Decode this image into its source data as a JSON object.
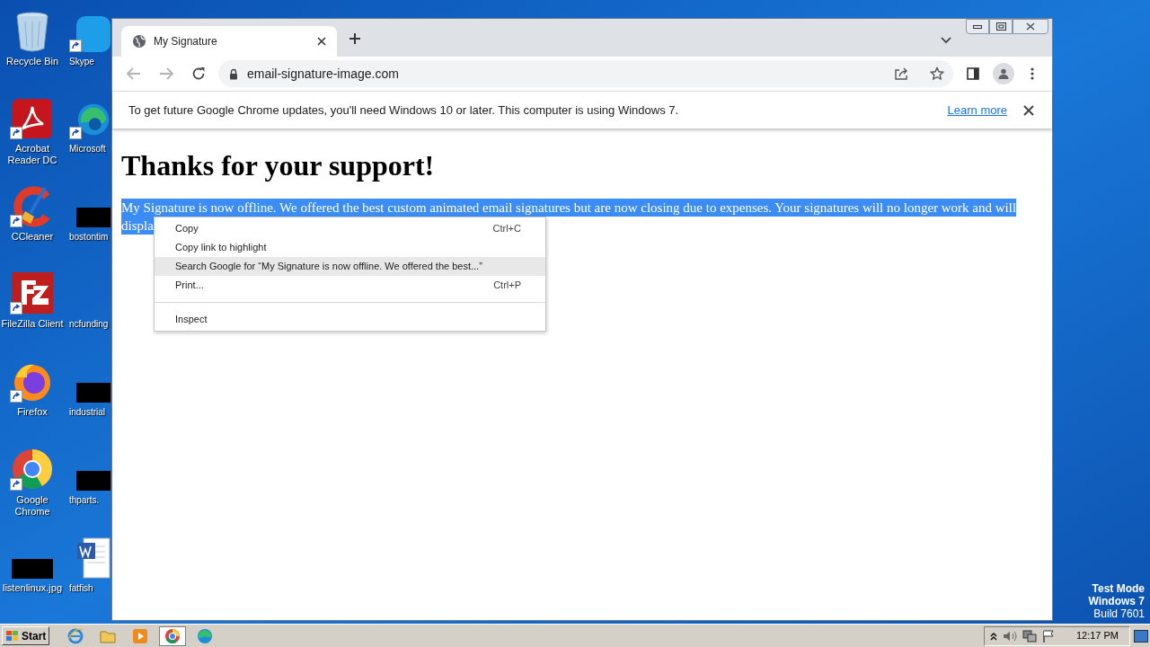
{
  "desktop_icons": [
    {
      "label": "Recycle Bin",
      "kind": "bin",
      "shortcut": false
    },
    {
      "label": "Skype",
      "kind": "skype",
      "shortcut": true
    },
    {
      "label": "Acrobat Reader DC",
      "kind": "acrobat",
      "shortcut": true
    },
    {
      "label": "Microsoft",
      "kind": "edge",
      "shortcut": true
    },
    {
      "label": "CCleaner",
      "kind": "ccleaner",
      "shortcut": true
    },
    {
      "label": "bostontim",
      "kind": "redacted",
      "shortcut": false
    },
    {
      "label": "FileZilla Client",
      "kind": "filezilla",
      "shortcut": true
    },
    {
      "label": "ncfunding",
      "kind": "blank",
      "shortcut": false
    },
    {
      "label": "Firefox",
      "kind": "firefox",
      "shortcut": true
    },
    {
      "label": "industrial",
      "kind": "redacted",
      "shortcut": false
    },
    {
      "label": "Google Chrome",
      "kind": "chrome",
      "shortcut": true
    },
    {
      "label": "thparts.",
      "kind": "redacted",
      "shortcut": false
    },
    {
      "label": "listenlinux.jpg",
      "kind": "redacted",
      "shortcut": false
    },
    {
      "label": "fatfish",
      "kind": "word",
      "shortcut": false
    }
  ],
  "browser": {
    "tabs": [
      {
        "title": "My Signature",
        "selected": true
      }
    ],
    "address": "email-signature-image.com",
    "infobar": {
      "message": "To get future Google Chrome updates, you'll need Windows 10 or later. This computer is using Windows 7.",
      "link": "Learn more"
    },
    "page": {
      "heading": "Thanks for your support!",
      "paragraph_lines": [
        "My Signature is now offline. We offered the best custom animated email signatures but are now closing due to expenses. Your signatures will no longer work and will",
        "displa"
      ]
    }
  },
  "context_menu": [
    {
      "kind": "item",
      "label": "Copy",
      "shortcut": "Ctrl+C",
      "selected": false
    },
    {
      "kind": "item",
      "label": "Copy link to highlight",
      "selected": false
    },
    {
      "kind": "item",
      "label": "Search Google for “My Signature is now offline. We offered the best...”",
      "selected": true
    },
    {
      "kind": "item",
      "label": "Print...",
      "shortcut": "Ctrl+P",
      "selected": false
    },
    {
      "kind": "separator"
    },
    {
      "kind": "item",
      "label": "Inspect",
      "selected": false
    }
  ],
  "watermark_text": [
    "Test Mode",
    "Windows 7",
    "Build 7601"
  ],
  "taskbar": {
    "start": "Start",
    "apps": [
      {
        "kind": "ie",
        "selected": false
      },
      {
        "kind": "explorer",
        "selected": false
      },
      {
        "kind": "media",
        "selected": false
      },
      {
        "kind": "chrome",
        "selected": true
      },
      {
        "kind": "edge",
        "selected": false
      }
    ],
    "clock": "12:17 PM"
  }
}
